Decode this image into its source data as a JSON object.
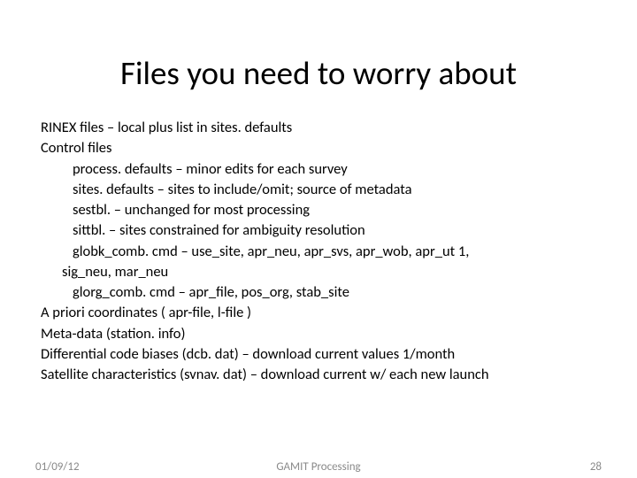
{
  "title": "Files you need to worry about",
  "lines": {
    "l0": "RINEX files – local plus list in sites. defaults",
    "l1": "Control files",
    "l2": "process. defaults – minor edits for each survey",
    "l3": "sites. defaults – sites to include/omit; source of metadata",
    "l4": "sestbl. – unchanged for most processing",
    "l5": "sittbl. – sites constrained for ambiguity resolution",
    "l6": "globk_comb. cmd –  use_site, apr_neu, apr_svs, apr_wob, apr_ut 1,",
    "l6b": "sig_neu, mar_neu",
    "l7": "glorg_comb. cmd – apr_file, pos_org, stab_site",
    "l8": "A priori coordinates ( apr-file,  l-file )",
    "l9": "Meta-data (station. info)",
    "l10": "Differential code biases (dcb. dat) –  download current values 1/month",
    "l11": "Satellite characteristics (svnav. dat) – download current w/ each new launch"
  },
  "footer": {
    "date": "01/09/12",
    "center": "GAMIT Processing",
    "page": "28"
  }
}
